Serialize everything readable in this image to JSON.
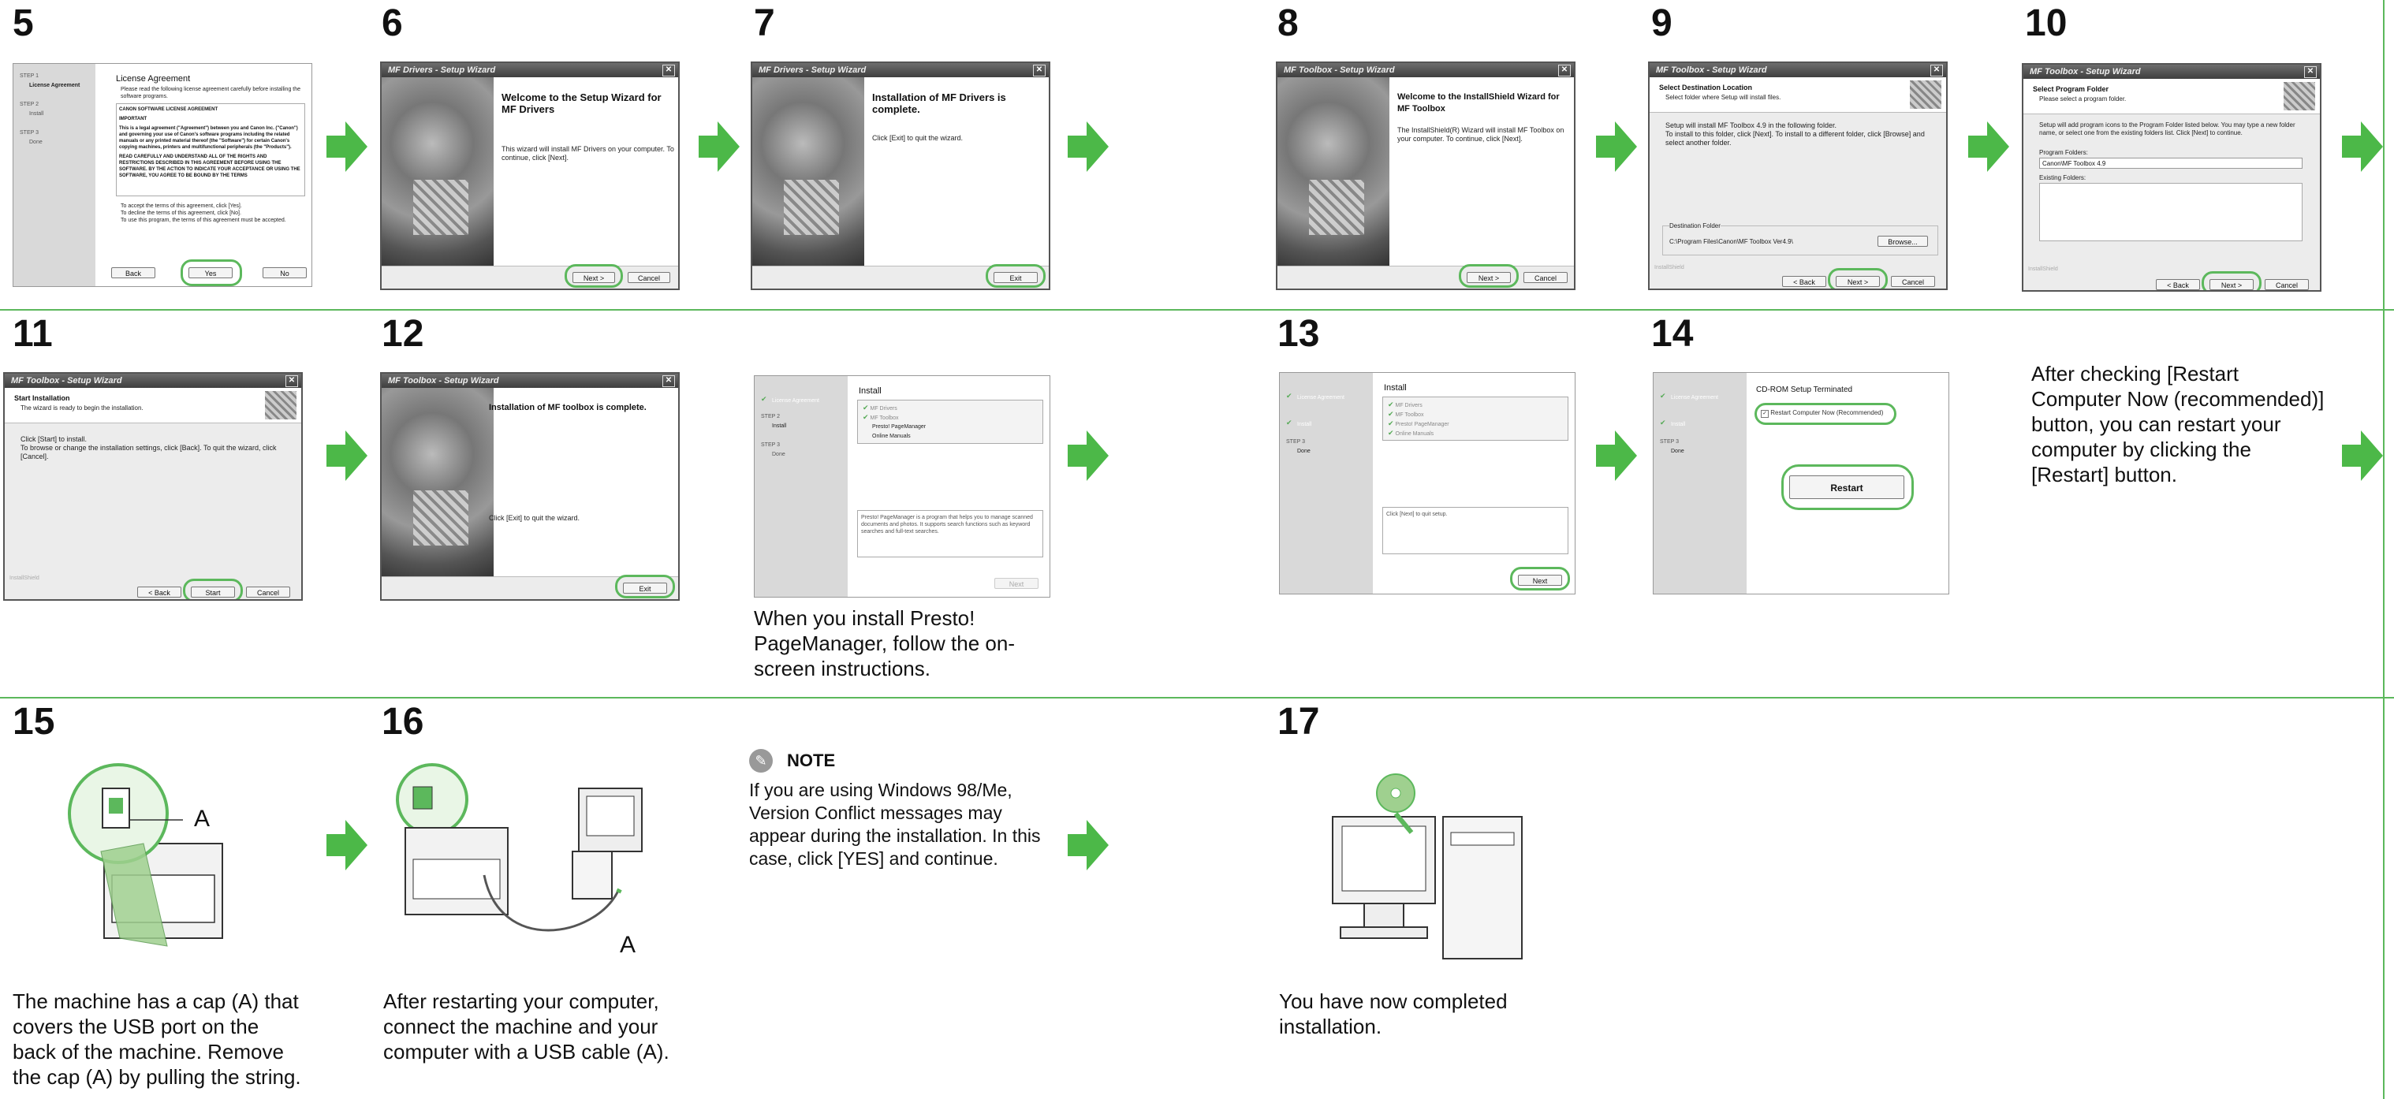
{
  "steps": {
    "s5": "5",
    "s6": "6",
    "s7": "7",
    "s8": "8",
    "s9": "9",
    "s10": "10",
    "s11": "11",
    "s12": "12",
    "s13": "13",
    "s14": "14",
    "s15": "15",
    "s16": "16",
    "s17": "17"
  },
  "win5": {
    "title": "License Agreement",
    "subtitle": "Please read the following license agreement carefully before installing the software programs.",
    "sidebar": [
      "STEP 1",
      "License Agreement",
      "STEP 2",
      "Install",
      "STEP 3",
      "Done"
    ],
    "agreement_head": "CANON SOFTWARE LICENSE AGREEMENT",
    "agreement_important": "IMPORTANT",
    "agreement_body": "This is a legal agreement (\"Agreement\") between you and Canon Inc. (\"Canon\") and governing your use of Canon's software programs including the related manuals or any printed material thereof (the \"Software\") for certain Canon's copying machines, printers and multifunctional peripherals (the \"Products\").",
    "agreement_read": "READ CAREFULLY AND UNDERSTAND ALL OF THE RIGHTS AND RESTRICTIONS DESCRIBED IN THIS AGREEMENT BEFORE USING THE SOFTWARE. BY THE ACTION TO INDICATE YOUR ACCEPTANCE OR USING THE SOFTWARE, YOU AGREE TO BE BOUND BY THE TERMS",
    "accept_text": "To accept the terms of this agreement, click [Yes].\nTo decline the terms of this agreement, click [No].\nTo use this program, the terms of this agreement must be accepted.",
    "back": "Back",
    "yes": "Yes",
    "no": "No"
  },
  "win6": {
    "titlebar": "MF Drivers - Setup Wizard",
    "heading": "Welcome to the Setup Wizard for MF Drivers",
    "body": "This wizard will install MF Drivers on your computer. To continue, click [Next].",
    "next": "Next >",
    "cancel": "Cancel"
  },
  "win7": {
    "titlebar": "MF Drivers - Setup Wizard",
    "heading": "Installation of MF Drivers is complete.",
    "body": "Click [Exit] to quit the wizard.",
    "exit": "Exit"
  },
  "win8": {
    "titlebar": "MF Toolbox - Setup Wizard",
    "heading": "Welcome to the InstallShield Wizard for MF Toolbox",
    "body": "The InstallShield(R) Wizard will install MF Toolbox on your computer. To continue, click [Next].",
    "next": "Next >",
    "cancel": "Cancel"
  },
  "win9": {
    "titlebar": "MF Toolbox - Setup Wizard",
    "heading": "Select Destination Location",
    "subheading": "Select folder where Setup will install files.",
    "body": "Setup will install MF Toolbox 4.9 in the following folder.\nTo install to this folder, click [Next]. To install to a different folder, click [Browse] and select another folder.",
    "dest_label": "Destination Folder",
    "dest_path": "C:\\Program Files\\Canon\\MF Toolbox Ver4.9\\",
    "browse": "Browse...",
    "footer_label": "InstallShield",
    "back": "< Back",
    "next": "Next >",
    "cancel": "Cancel"
  },
  "win10": {
    "titlebar": "MF Toolbox - Setup Wizard",
    "heading": "Select Program Folder",
    "subheading": "Please select a program folder.",
    "body": "Setup will add program icons to the Program Folder listed below. You may type a new folder name, or select one from the existing folders list. Click [Next] to continue.",
    "program_label": "Program Folders:",
    "program_value": "Canon\\MF Toolbox 4.9",
    "existing_label": "Existing Folders:",
    "footer_label": "InstallShield",
    "back": "< Back",
    "next": "Next >",
    "cancel": "Cancel"
  },
  "win11": {
    "titlebar": "MF Toolbox - Setup Wizard",
    "heading": "Start Installation",
    "subheading": "The wizard is ready to begin the installation.",
    "body": "Click [Start] to install.\nTo browse or change the installation settings, click [Back]. To quit the wizard, click [Cancel].",
    "footer_label": "InstallShield",
    "back": "< Back",
    "start": "Start",
    "cancel": "Cancel"
  },
  "win12": {
    "titlebar": "MF Toolbox - Setup Wizard",
    "heading": "Installation of MF toolbox is complete.",
    "body": "Click [Exit] to quit the wizard.",
    "exit": "Exit"
  },
  "winInstallA": {
    "title": "Install",
    "sidebar": [
      "License Agreement",
      "STEP 2",
      "Install",
      "STEP 3",
      "Done"
    ],
    "items": [
      "MF Drivers",
      "MF Toolbox",
      "Presto! PageManager",
      "Online Manuals"
    ],
    "desc": "Presto! PageManager is a program that helps you to manage scanned documents and photos. It supports search functions such as keyword searches and full-text searches.",
    "next": "Next"
  },
  "winInstallB": {
    "title": "Install",
    "sidebar": [
      "License Agreement",
      "Install",
      "STEP 3",
      "Done"
    ],
    "items": [
      "MF Drivers",
      "MF Toolbox",
      "Presto! PageManager",
      "Online Manuals"
    ],
    "desc": "Click [Next] to quit setup.",
    "next": "Next"
  },
  "win14": {
    "title": "CD-ROM Setup Terminated",
    "sidebar": [
      "License Agreement",
      "Install",
      "STEP 3",
      "Done"
    ],
    "restart_check": "Restart Computer Now (Recommended)",
    "restart": "Restart"
  },
  "captions": {
    "presto": "When you install Presto!\nPageManager, follow the on-\nscreen instructions.",
    "restart_note": "After checking [Restart\nComputer Now (recommended)]\nbutton, you can restart your\ncomputer by clicking the\n[Restart] button.",
    "cap15": "The machine has a cap (A) that\ncovers the USB port on the\nback of the machine. Remove\nthe cap (A) by pulling the string.",
    "cap16": "After restarting your computer,\nconnect the machine and your\ncomputer with a USB cable (A).",
    "note_title": "NOTE",
    "note_body": "If you are using Windows 98/Me,\nVersion Conflict messages may\nappear during the installation. In this\ncase, click [YES] and continue.",
    "cap17": "You have now completed\ninstallation.",
    "label_a15": "A",
    "label_a16": "A"
  },
  "colors": {
    "accent_green": "#5cb85c",
    "arrow_green": "#4cb848"
  }
}
